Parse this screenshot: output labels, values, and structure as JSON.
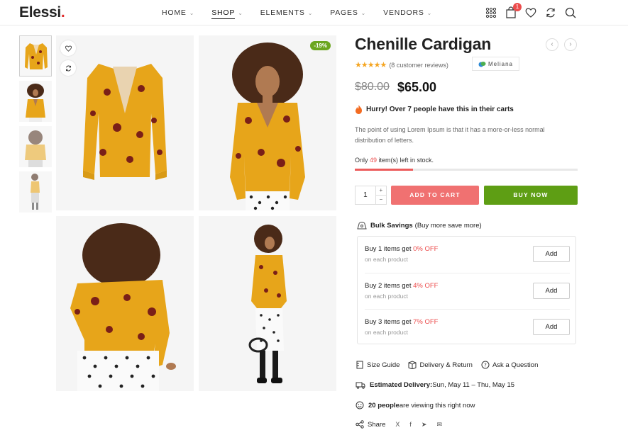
{
  "header": {
    "logo_text": "Elessi",
    "logo_dot": ".",
    "nav": [
      {
        "label": "HOME",
        "has_dropdown": true
      },
      {
        "label": "SHOP",
        "has_dropdown": true,
        "active": true
      },
      {
        "label": "ELEMENTS",
        "has_dropdown": true
      },
      {
        "label": "PAGES",
        "has_dropdown": true
      },
      {
        "label": "VENDORS",
        "has_dropdown": true
      }
    ],
    "icons": [
      "apps-grid-icon",
      "cart-icon",
      "wishlist-heart-icon",
      "compare-icon",
      "search-icon"
    ],
    "cart_count": "1"
  },
  "gallery": {
    "sale_badge": "-19%",
    "thumbnails": [
      "front-flat",
      "model-front",
      "model-back",
      "model-full"
    ],
    "images": [
      "cardigan-front",
      "model-front",
      "model-back",
      "model-full-body"
    ]
  },
  "product": {
    "title": "Chenille Cardigan",
    "rating": 4.5,
    "stars": "★★★★★",
    "reviews": "(8 customer reviews)",
    "brand": "Meliana",
    "old_price": "$80.00",
    "new_price": "$65.00",
    "hurry": "Hurry! Over 7 people have this in their carts",
    "description": "The point of using Lorem Ipsum is that it has a more-or-less normal distribution of letters.",
    "stock_prefix": "Only ",
    "stock_num": "49",
    "stock_suffix": " item(s) left in stock.",
    "stock_level": 0.26,
    "quantity": "1",
    "add_to_cart": "ADD TO CART",
    "buy_now": "BUY NOW"
  },
  "bulk": {
    "title": "Bulk Savings",
    "subtitle": "(Buy more save more)",
    "tiers": [
      {
        "prefix": "Buy 1 items get ",
        "off": "0% OFF",
        "note": "on each product",
        "add": "Add"
      },
      {
        "prefix": "Buy 2 items get ",
        "off": "4% OFF",
        "note": "on each product",
        "add": "Add"
      },
      {
        "prefix": "Buy 3 items get ",
        "off": "7% OFF",
        "note": "on each product",
        "add": "Add"
      }
    ]
  },
  "extras": {
    "size_guide": "Size Guide",
    "delivery_return": "Delivery & Return",
    "ask_question": "Ask a Question",
    "estimated_label": "Estimated Delivery:",
    "estimated_value": " Sun, May 11 – Thu, May 15",
    "viewing_count": "20 people",
    "viewing_text": " are viewing this right now",
    "share": "Share",
    "share_icons": [
      "x-icon",
      "facebook-icon",
      "telegram-icon",
      "email-icon"
    ],
    "share_glyphs": [
      "X",
      "f",
      "➤",
      "✉"
    ]
  },
  "colors": {
    "accent_red": "#f07171",
    "buy_green": "#5e9e14",
    "sale_green": "#6ba61f",
    "cardigan_yellow": "#e7a51a"
  }
}
